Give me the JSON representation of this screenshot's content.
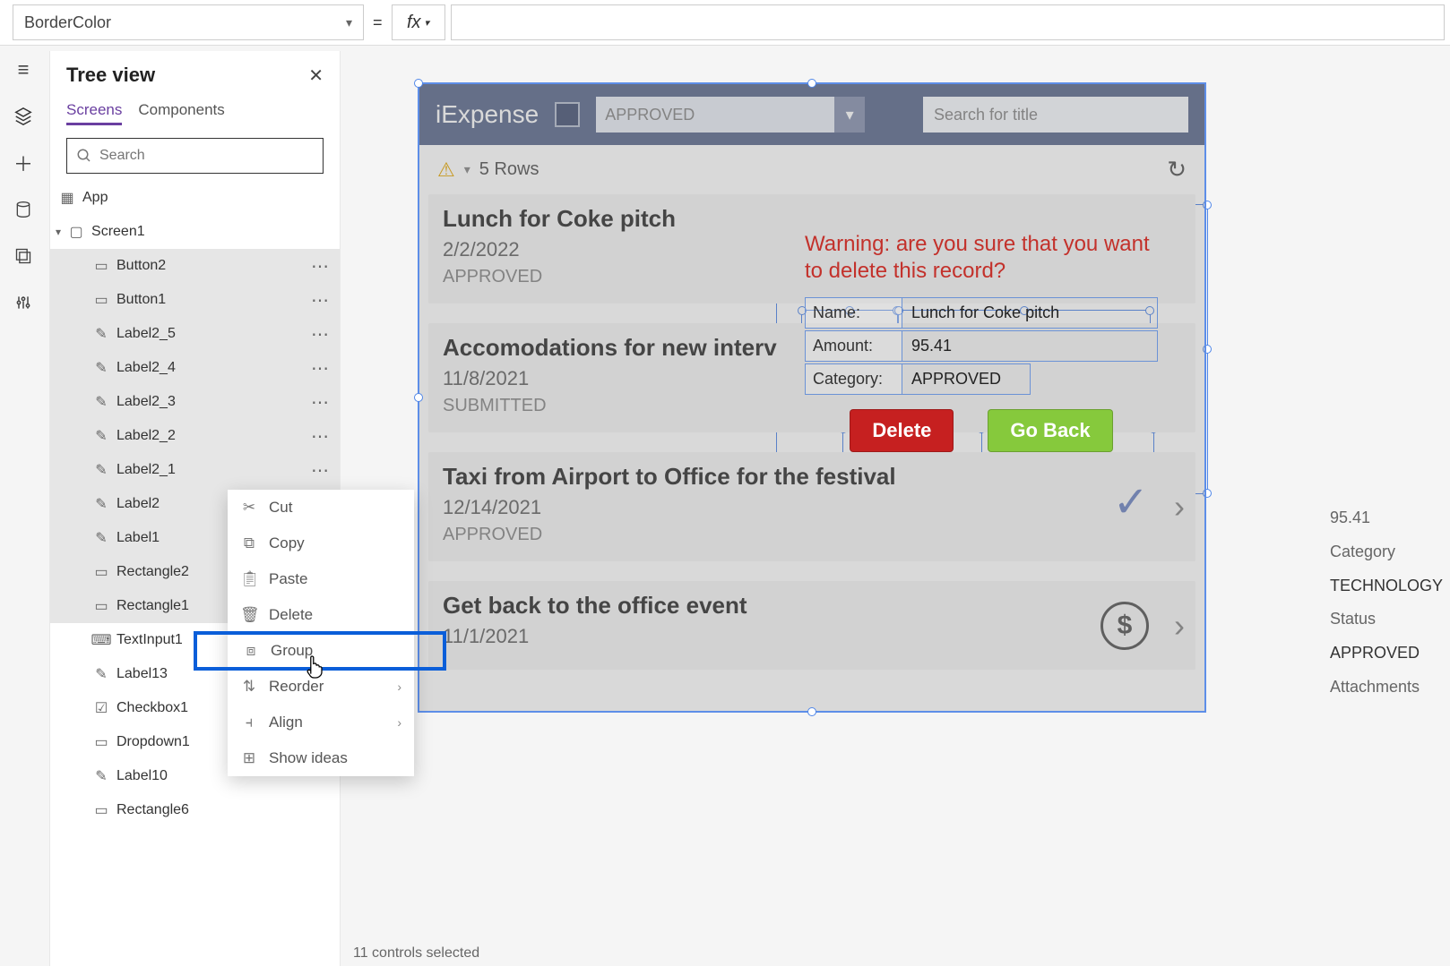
{
  "topbar": {
    "property": "BorderColor",
    "equals": "=",
    "fx": "fx"
  },
  "tree": {
    "title": "Tree view",
    "tab_screens": "Screens",
    "tab_components": "Components",
    "search_placeholder": "Search",
    "nodes": {
      "app": "App",
      "screen1": "Screen1",
      "items": [
        {
          "label": "Button2",
          "sel": true
        },
        {
          "label": "Button1",
          "sel": true
        },
        {
          "label": "Label2_5",
          "sel": true
        },
        {
          "label": "Label2_4",
          "sel": true
        },
        {
          "label": "Label2_3",
          "sel": true
        },
        {
          "label": "Label2_2",
          "sel": true
        },
        {
          "label": "Label2_1",
          "sel": true
        },
        {
          "label": "Label2",
          "sel": true
        },
        {
          "label": "Label1",
          "sel": true
        },
        {
          "label": "Rectangle2",
          "sel": true
        },
        {
          "label": "Rectangle1",
          "sel": true
        },
        {
          "label": "TextInput1",
          "sel": false
        },
        {
          "label": "Label13",
          "sel": false
        },
        {
          "label": "Checkbox1",
          "sel": false
        },
        {
          "label": "Dropdown1",
          "sel": false
        },
        {
          "label": "Label10",
          "sel": false
        },
        {
          "label": "Rectangle6",
          "sel": false
        }
      ]
    }
  },
  "ctx": {
    "cut": "Cut",
    "copy": "Copy",
    "paste": "Paste",
    "delete": "Delete",
    "group": "Group",
    "reorder": "Reorder",
    "align": "Align",
    "show_ideas": "Show ideas"
  },
  "app": {
    "title": "iExpense",
    "dropdown": "APPROVED",
    "search_placeholder": "Search for title",
    "rows_text": "5 Rows",
    "cards": [
      {
        "title": "Lunch for Coke pitch",
        "date": "2/2/2022",
        "status": "APPROVED"
      },
      {
        "title": "Accomodations for new interv",
        "date": "11/8/2021",
        "status": "SUBMITTED"
      },
      {
        "title": "Taxi from Airport to Office for the festival",
        "date": "12/14/2021",
        "status": "APPROVED"
      },
      {
        "title": "Get back to the office event",
        "date": "11/1/2021",
        "status": ""
      }
    ],
    "dialog": {
      "warning": "Warning: are you sure that you want to delete this record?",
      "name_k": "Name:",
      "name_v": "Lunch for Coke pitch",
      "amount_k": "Amount:",
      "amount_v": "95.41",
      "category_k": "Category:",
      "category_v": "APPROVED",
      "delete": "Delete",
      "goback": "Go Back"
    },
    "right": {
      "amount": "95.41",
      "cat_label": "Category",
      "cat_value": "TECHNOLOGY",
      "status_label": "Status",
      "status_value": "APPROVED",
      "attach": "Attachments"
    }
  },
  "status": "11 controls selected"
}
